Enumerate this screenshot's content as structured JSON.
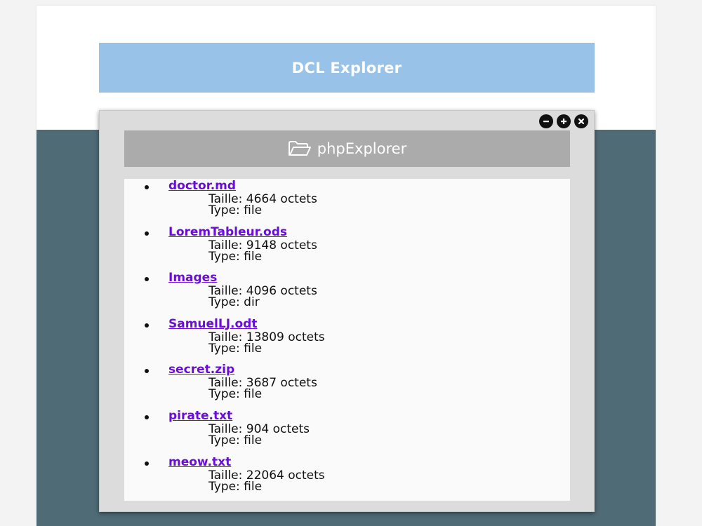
{
  "header": {
    "title": "DCL Explorer"
  },
  "window": {
    "title": "phpExplorer",
    "controls": [
      {
        "name": "minimize",
        "icon": "minus-circle-icon"
      },
      {
        "name": "maximize",
        "icon": "plus-circle-icon"
      },
      {
        "name": "close",
        "icon": "close-circle-icon"
      }
    ],
    "title_icon": "folder-open-icon"
  },
  "files": [
    {
      "name": "doctor.md",
      "size_label": "Taille: 4664 octets",
      "type_label": "Type: file"
    },
    {
      "name": "LoremTableur.ods",
      "size_label": "Taille: 9148 octets",
      "type_label": "Type: file"
    },
    {
      "name": "Images",
      "size_label": "Taille: 4096 octets",
      "type_label": "Type: dir"
    },
    {
      "name": "SamuelLJ.odt",
      "size_label": "Taille: 13809 octets",
      "type_label": "Type: file"
    },
    {
      "name": "secret.zip",
      "size_label": "Taille: 3687 octets",
      "type_label": "Type: file"
    },
    {
      "name": "pirate.txt",
      "size_label": "Taille: 904 octets",
      "type_label": "Type: file"
    },
    {
      "name": "meow.txt",
      "size_label": "Taille: 22064 octets",
      "type_label": "Type: file"
    }
  ],
  "colors": {
    "banner": "#99c2e8",
    "band": "#4f6b75",
    "window": "#dcdcdc",
    "title_bar": "#ababab",
    "link": "#6a0dd8"
  }
}
